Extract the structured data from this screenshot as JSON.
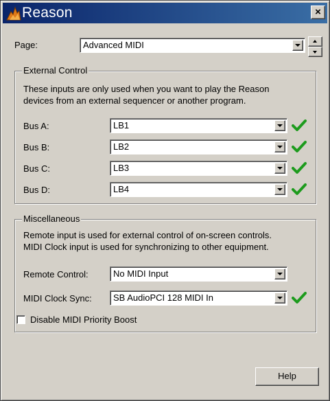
{
  "window": {
    "title": "Reason",
    "close_label": "×"
  },
  "page_selector": {
    "label": "Page:",
    "value": "Advanced MIDI"
  },
  "external_control": {
    "title": "External Control",
    "description_line1": "These inputs are only used when you want to play the Reason",
    "description_line2": "devices from an external sequencer or another program.",
    "buses": [
      {
        "label": "Bus A:",
        "value": "LB1",
        "ok": true
      },
      {
        "label": "Bus B:",
        "value": "LB2",
        "ok": true
      },
      {
        "label": "Bus C:",
        "value": "LB3",
        "ok": true
      },
      {
        "label": "Bus D:",
        "value": "LB4",
        "ok": true
      }
    ]
  },
  "miscellaneous": {
    "title": "Miscellaneous",
    "description_line1": "Remote input is used for external control of on-screen controls.",
    "description_line2": "MIDI Clock input is used for synchronizing to other equipment.",
    "remote_control": {
      "label": "Remote Control:",
      "value": "No MIDI Input"
    },
    "midi_clock_sync": {
      "label": "MIDI Clock Sync:",
      "value": "SB AudioPCI 128 MIDI In",
      "ok": true
    },
    "disable_priority_boost": {
      "label": "Disable MIDI Priority Boost",
      "checked": false
    }
  },
  "help_button": {
    "label": "Help"
  },
  "colors": {
    "check_green": "#1d9b1d",
    "titlebar_start": "#0a246a",
    "titlebar_end": "#3a6ea5"
  }
}
